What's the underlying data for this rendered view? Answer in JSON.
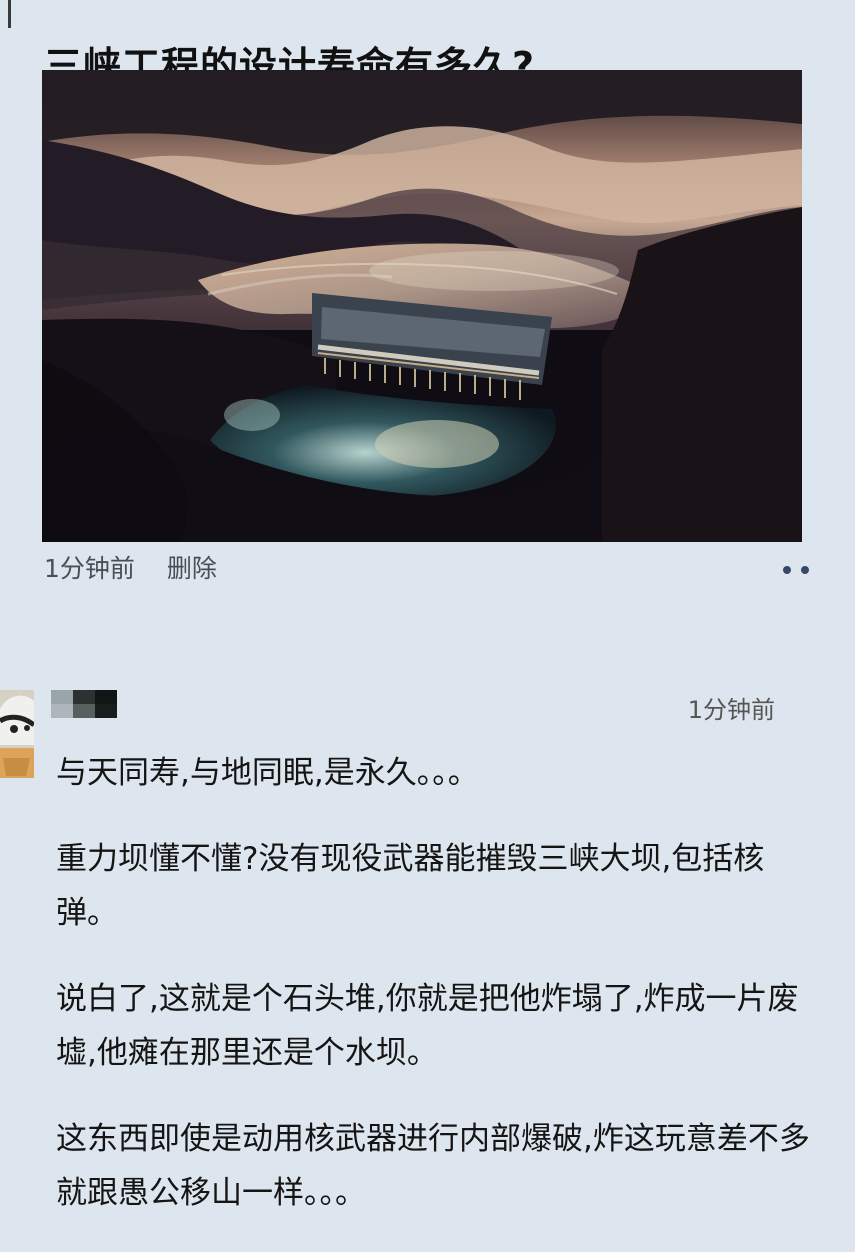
{
  "post": {
    "title": "三峡工程的设计寿命有多久?",
    "image_icon": "three-gorges-dam-photo",
    "time": "1分钟前",
    "delete_label": "删除",
    "more_icon": "more-icon"
  },
  "comment": {
    "avatar_icon": "user-avatar",
    "time": "1分钟前",
    "paragraphs": [
      "与天同寿,与地同眠,是永久。。。",
      "重力坝懂不懂?没有现役武器能摧毁三峡大坝,包括核弹。",
      "说白了,这就是个石头堆,你就是把他炸塌了,炸成一片废墟,他瘫在那里还是个水坝。",
      "这东西即使是动用核武器进行内部爆破,炸这玩意差不多就跟愚公移山一样。。。"
    ]
  },
  "colors": {
    "background": "#dde6ee",
    "text": "#151515",
    "meta_text": "#4b4f55",
    "more_dots": "#344966"
  }
}
